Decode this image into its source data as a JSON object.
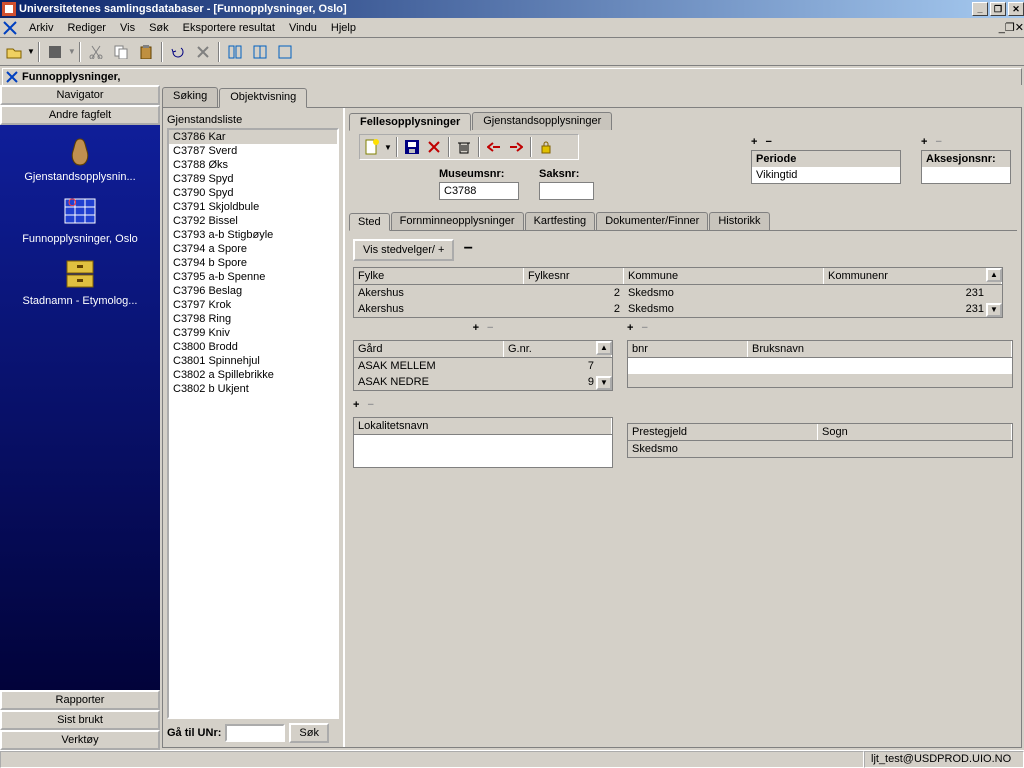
{
  "window": {
    "title": "Universitetenes samlingsdatabaser - [Funnopplysninger, Oslo]"
  },
  "menu": {
    "items": [
      "Arkiv",
      "Rediger",
      "Vis",
      "Søk",
      "Eksportere resultat",
      "Vindu",
      "Hjelp"
    ]
  },
  "childwin": {
    "title": "Funnopplysninger,"
  },
  "leftnav": {
    "navigator": "Navigator",
    "andre": "Andre fagfelt",
    "icons": [
      {
        "label": "Gjenstandsopplysnin..."
      },
      {
        "label": "Funnopplysninger, Oslo"
      },
      {
        "label": "Stadnamn - Etymolog..."
      }
    ],
    "rapporter": "Rapporter",
    "sistbrukt": "Sist brukt",
    "verktoy": "Verktøy"
  },
  "maintabs": {
    "soking": "Søking",
    "objektvisning": "Objektvisning"
  },
  "list": {
    "header": "Gjenstandsliste",
    "items": [
      "C3786  Kar",
      "C3787  Sverd",
      "C3788  Øks",
      "C3789  Spyd",
      "C3790  Spyd",
      "C3791  Skjoldbule",
      "C3792  Bissel",
      "C3793 a-b Stigbøyle",
      "C3794 a Spore",
      "C3794 b Spore",
      "C3795 a-b Spenne",
      "C3796  Beslag",
      "C3797  Krok",
      "C3798  Ring",
      "C3799  Kniv",
      "C3800  Brodd",
      "C3801  Spinnehjul",
      "C3802 a Spillebrikke",
      "C3802 b Ukjent"
    ],
    "goto_label": "Gå til UNr:",
    "goto_value": "",
    "sok": "Søk"
  },
  "subtabs": {
    "felles": "Fellesopplysninger",
    "gjenstand": "Gjenstandsopplysninger"
  },
  "fields": {
    "museumsnr_label": "Museumsnr:",
    "museumsnr": "C3788",
    "saksnr_label": "Saksnr:",
    "saksnr": "",
    "periode_label": "Periode",
    "periode": "Vikingtid",
    "aksesjon_label": "Aksesjonsnr:",
    "aksesjon": ""
  },
  "stedtabs": [
    "Sted",
    "Fornminneopplysninger",
    "Kartfesting",
    "Dokumenter/Finner",
    "Historikk"
  ],
  "sted": {
    "vis": "Vis stedvelger/ +",
    "fylke_cols": [
      "Fylke",
      "Fylkesnr",
      "Kommune",
      "Kommunenr"
    ],
    "fylke_rows": [
      {
        "fylke": "Akershus",
        "fylkesnr": "2",
        "kommune": "Skedsmo",
        "kommunenr": "231"
      },
      {
        "fylke": "Akershus",
        "fylkesnr": "2",
        "kommune": "Skedsmo",
        "kommunenr": "231"
      }
    ],
    "gard_cols": [
      "Gård",
      "G.nr."
    ],
    "gard_rows": [
      {
        "gard": "ASAK MELLEM",
        "gnr": "7"
      },
      {
        "gard": "ASAK NEDRE",
        "gnr": "9"
      }
    ],
    "bnr_cols": [
      "bnr",
      "Bruksnavn"
    ],
    "lokalitet_label": "Lokalitetsnavn",
    "lokalitet": "",
    "prestegjeld_label": "Prestegjeld",
    "prestegjeld": "Skedsmo",
    "sogn_label": "Sogn",
    "sogn": ""
  },
  "status": {
    "user": "ljt_test@USDPROD.UIO.NO"
  }
}
